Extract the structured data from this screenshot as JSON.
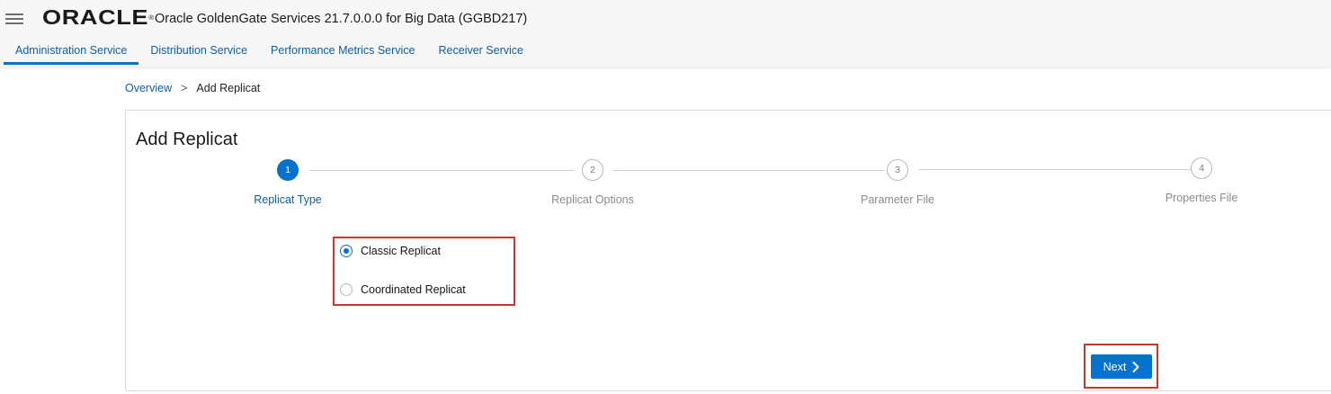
{
  "header": {
    "logo_text": "ORACLE",
    "logo_mark": "®",
    "app_title": "Oracle GoldenGate Services 21.7.0.0.0 for Big Data (GGBD217)",
    "menu_icon": "hamburger-menu-icon"
  },
  "tabs": [
    {
      "label": "Administration Service",
      "active": true
    },
    {
      "label": "Distribution Service",
      "active": false
    },
    {
      "label": "Performance Metrics Service",
      "active": false
    },
    {
      "label": "Receiver Service",
      "active": false
    }
  ],
  "breadcrumb": {
    "parent": "Overview",
    "separator": ">",
    "current": "Add Replicat"
  },
  "panel": {
    "title": "Add Replicat"
  },
  "steps": [
    {
      "number": "1",
      "label": "Replicat Type",
      "active": true
    },
    {
      "number": "2",
      "label": "Replicat Options",
      "active": false
    },
    {
      "number": "3",
      "label": "Parameter File",
      "active": false
    },
    {
      "number": "4",
      "label": "Properties File",
      "active": false
    }
  ],
  "replicat_options": [
    {
      "label": "Classic Replicat",
      "selected": true
    },
    {
      "label": "Coordinated Replicat",
      "selected": false
    }
  ],
  "actions": {
    "next_label": "Next",
    "next_icon": "chevron-right-icon"
  },
  "colors": {
    "accent": "#0572ce",
    "link": "#0b5ea8",
    "highlight_border": "#c0392b"
  }
}
